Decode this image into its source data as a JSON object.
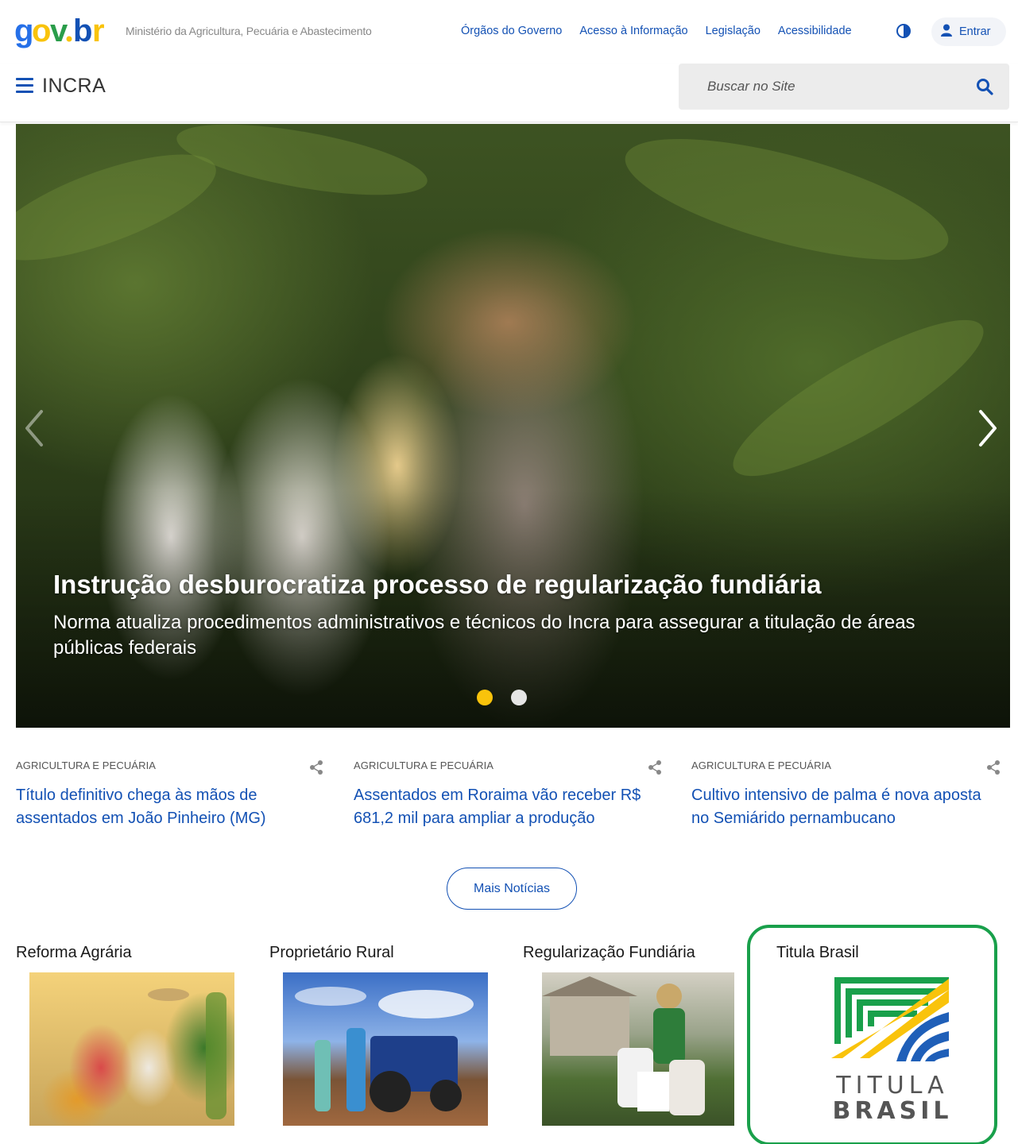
{
  "header": {
    "logo_text": "gov.br",
    "ministry": "Ministério da Agricultura, Pecuária e Abastecimento",
    "links": [
      "Órgãos do Governo",
      "Acesso à Informação",
      "Legislação",
      "Acessibilidade"
    ],
    "login_label": "Entrar",
    "contrast_icon": "contrast-icon",
    "user_icon": "user-icon"
  },
  "nav": {
    "site_name": "INCRA",
    "search_placeholder": "Buscar no Site",
    "menu_icon": "hamburger-menu-icon",
    "search_icon": "search-icon"
  },
  "hero": {
    "title": "Instrução desburocratiza processo de regularização fundiária",
    "subtitle": "Norma atualiza procedimentos administrativos e técnicos do Incra para assegurar a titulação de áreas públicas federais",
    "slide_count": 2,
    "active_slide": 1
  },
  "news": [
    {
      "category": "AGRICULTURA E PECUÁRIA",
      "title": "Título definitivo chega às mãos de assentados em João Pinheiro (MG)"
    },
    {
      "category": "AGRICULTURA E PECUÁRIA",
      "title": "Assentados em Roraima vão receber R$ 681,2 mil para ampliar a produção"
    },
    {
      "category": "AGRICULTURA E PECUÁRIA",
      "title": "Cultivo intensivo de palma é nova aposta no Semiárido pernambucano"
    }
  ],
  "more_news_label": "Mais Notícias",
  "features": [
    {
      "title": "Reforma Agrária"
    },
    {
      "title": "Proprietário Rural"
    },
    {
      "title": "Regularização Fundiária"
    },
    {
      "title": "Titula Brasil",
      "logo_line1": "TITULA",
      "logo_line2": "BRASIL"
    }
  ],
  "colors": {
    "primary_blue": "#1351b4",
    "gov_green": "#2a9d4a",
    "gov_yellow": "#f9c30b",
    "highlight_green": "#19a04b"
  }
}
